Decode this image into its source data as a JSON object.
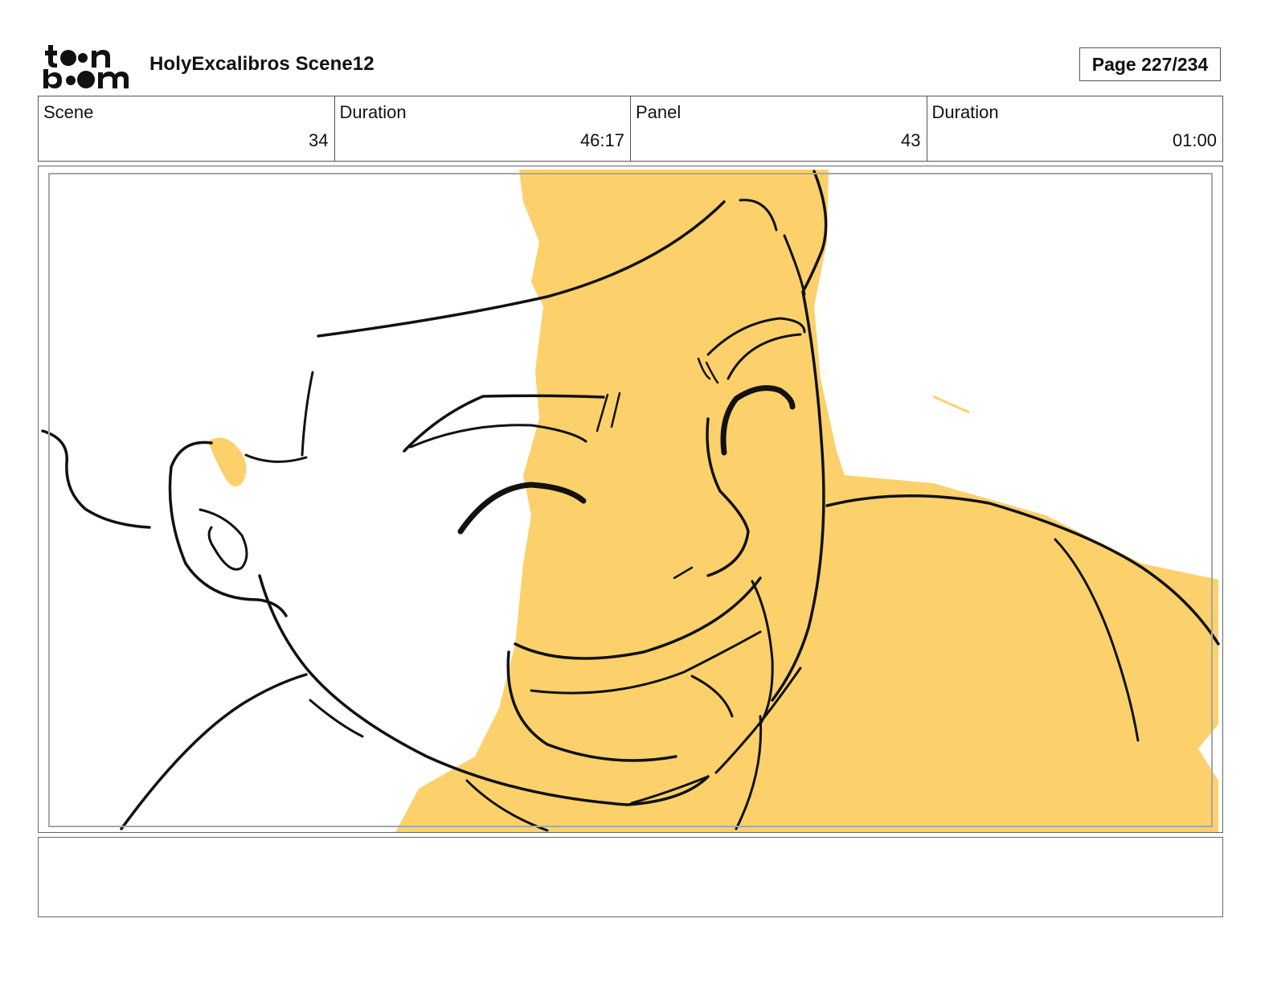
{
  "header": {
    "logo_text": "toon boom",
    "title": "HolyExcalibros Scene12",
    "page_label": "Page 227/234"
  },
  "info": [
    {
      "label": "Scene",
      "value": "34"
    },
    {
      "label": "Duration",
      "value": "46:17"
    },
    {
      "label": "Panel",
      "value": "43"
    },
    {
      "label": "Duration",
      "value": "01:00"
    }
  ],
  "panel": {
    "fill_color": "#fcd16b",
    "line_color": "#111111"
  },
  "notes": {
    "text": ""
  }
}
